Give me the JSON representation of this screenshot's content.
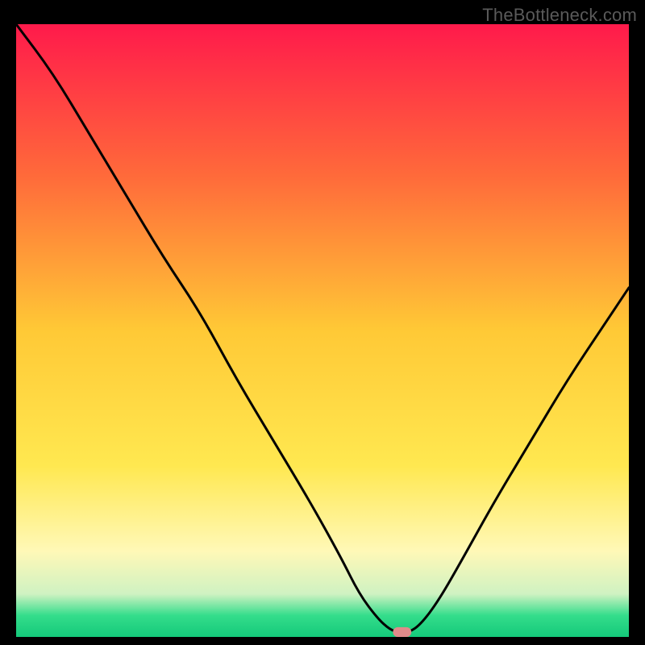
{
  "watermark": {
    "text": "TheBottleneck.com"
  },
  "chart_data": {
    "type": "line",
    "title": "",
    "xlabel": "",
    "ylabel": "",
    "xlim": [
      0,
      100
    ],
    "ylim": [
      0,
      100
    ],
    "gradient_stops": [
      {
        "offset": 0.0,
        "color": "#ff1a4b"
      },
      {
        "offset": 0.25,
        "color": "#ff6b3a"
      },
      {
        "offset": 0.5,
        "color": "#ffc936"
      },
      {
        "offset": 0.72,
        "color": "#ffe850"
      },
      {
        "offset": 0.86,
        "color": "#fff8b7"
      },
      {
        "offset": 0.93,
        "color": "#cff2c2"
      },
      {
        "offset": 0.965,
        "color": "#34dd8b"
      },
      {
        "offset": 1.0,
        "color": "#14c97a"
      }
    ],
    "curve": {
      "x": [
        0,
        6,
        12,
        18,
        24,
        30,
        36,
        42,
        48,
        53,
        56,
        59,
        61,
        62.5,
        64,
        66,
        69,
        73,
        78,
        84,
        90,
        96,
        100
      ],
      "y": [
        100,
        92,
        82,
        72,
        62,
        53,
        42,
        32,
        22,
        13,
        7,
        3,
        1.2,
        0.7,
        0.7,
        2,
        6,
        13,
        22,
        32,
        42,
        51,
        57
      ]
    },
    "pink_marker": {
      "x": 63,
      "y": 0.8,
      "w": 3.0,
      "h": 1.6
    }
  }
}
